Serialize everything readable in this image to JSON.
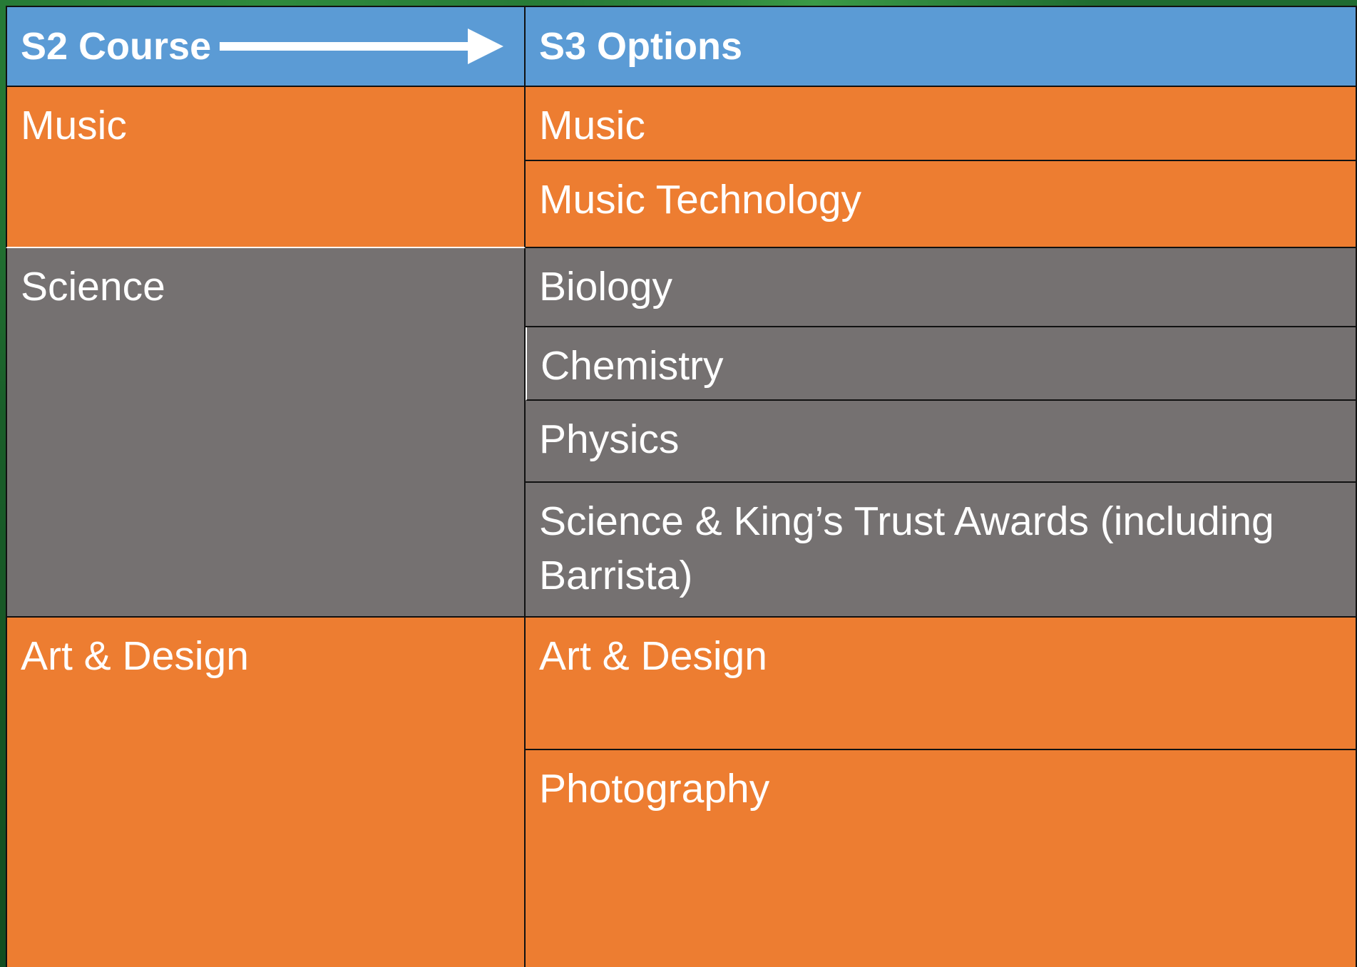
{
  "header": {
    "left": "S2 Course",
    "right": "S3 Options"
  },
  "rows": [
    {
      "course": "Music",
      "options": [
        "Music",
        "Music Technology"
      ]
    },
    {
      "course": "Science",
      "options": [
        "Biology",
        "Chemistry",
        "Physics",
        "Science & King’s Trust Awards (including Barrista)"
      ]
    },
    {
      "course": "Art & Design",
      "options": [
        "Art & Design",
        "Photography"
      ]
    }
  ],
  "colors": {
    "header": "#5b9bd5",
    "orange": "#ed7d31",
    "grey": "#757171",
    "background": "#1b5e2a"
  }
}
